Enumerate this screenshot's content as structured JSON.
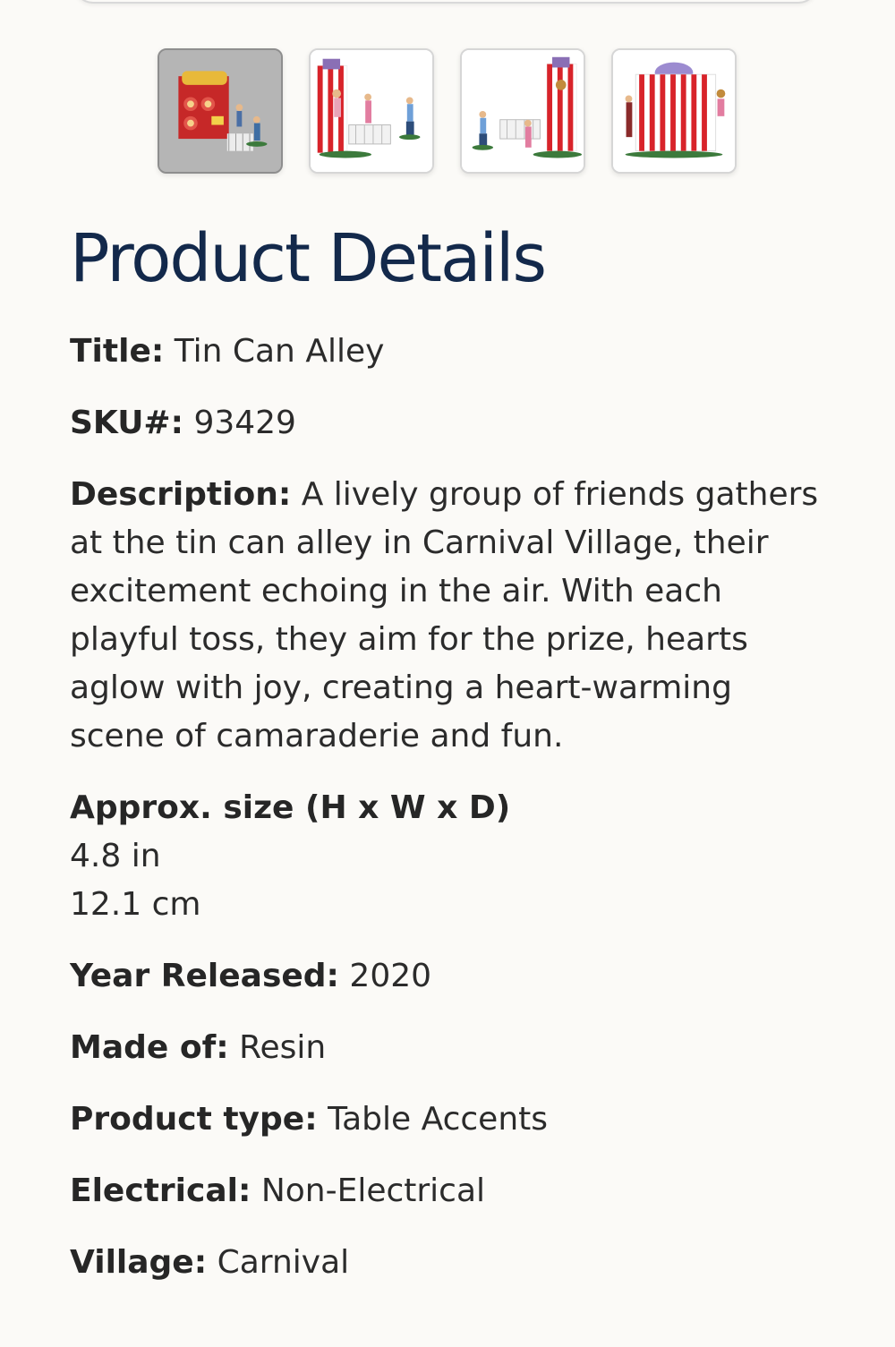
{
  "gallery": {
    "thumbnails": [
      {
        "alt": "tin-can-alley-scene",
        "selected": true
      },
      {
        "alt": "tin-can-alley-side-view",
        "selected": false
      },
      {
        "alt": "tin-can-alley-other-side",
        "selected": false
      },
      {
        "alt": "tin-can-alley-back-view",
        "selected": false
      }
    ]
  },
  "heading": "Product Details",
  "details": {
    "title": {
      "label": "Title:",
      "value": "Tin Can Alley"
    },
    "sku": {
      "label": "SKU#:",
      "value": "93429"
    },
    "description": {
      "label": "Description:",
      "value": "A lively group of friends gathers at the tin can alley in Carnival Village, their excitement echoing in the air. With each playful toss, they aim for the prize, hearts aglow with joy, creating a heart-warming scene of camaraderie and fun."
    },
    "size": {
      "label": "Approx. size (H x W x D)",
      "inches": "4.8 in",
      "cm": "12.1 cm"
    },
    "year": {
      "label": "Year Released:",
      "value": "2020"
    },
    "material": {
      "label": "Made of:",
      "value": "Resin"
    },
    "product_type": {
      "label": "Product type:",
      "value": "Table Accents"
    },
    "electrical": {
      "label": "Electrical:",
      "value": "Non-Electrical"
    },
    "village": {
      "label": "Village:",
      "value": "Carnival"
    }
  },
  "colors": {
    "heading": "#13294b",
    "stripe_red": "#d8232a",
    "background": "#fbfaf7"
  }
}
